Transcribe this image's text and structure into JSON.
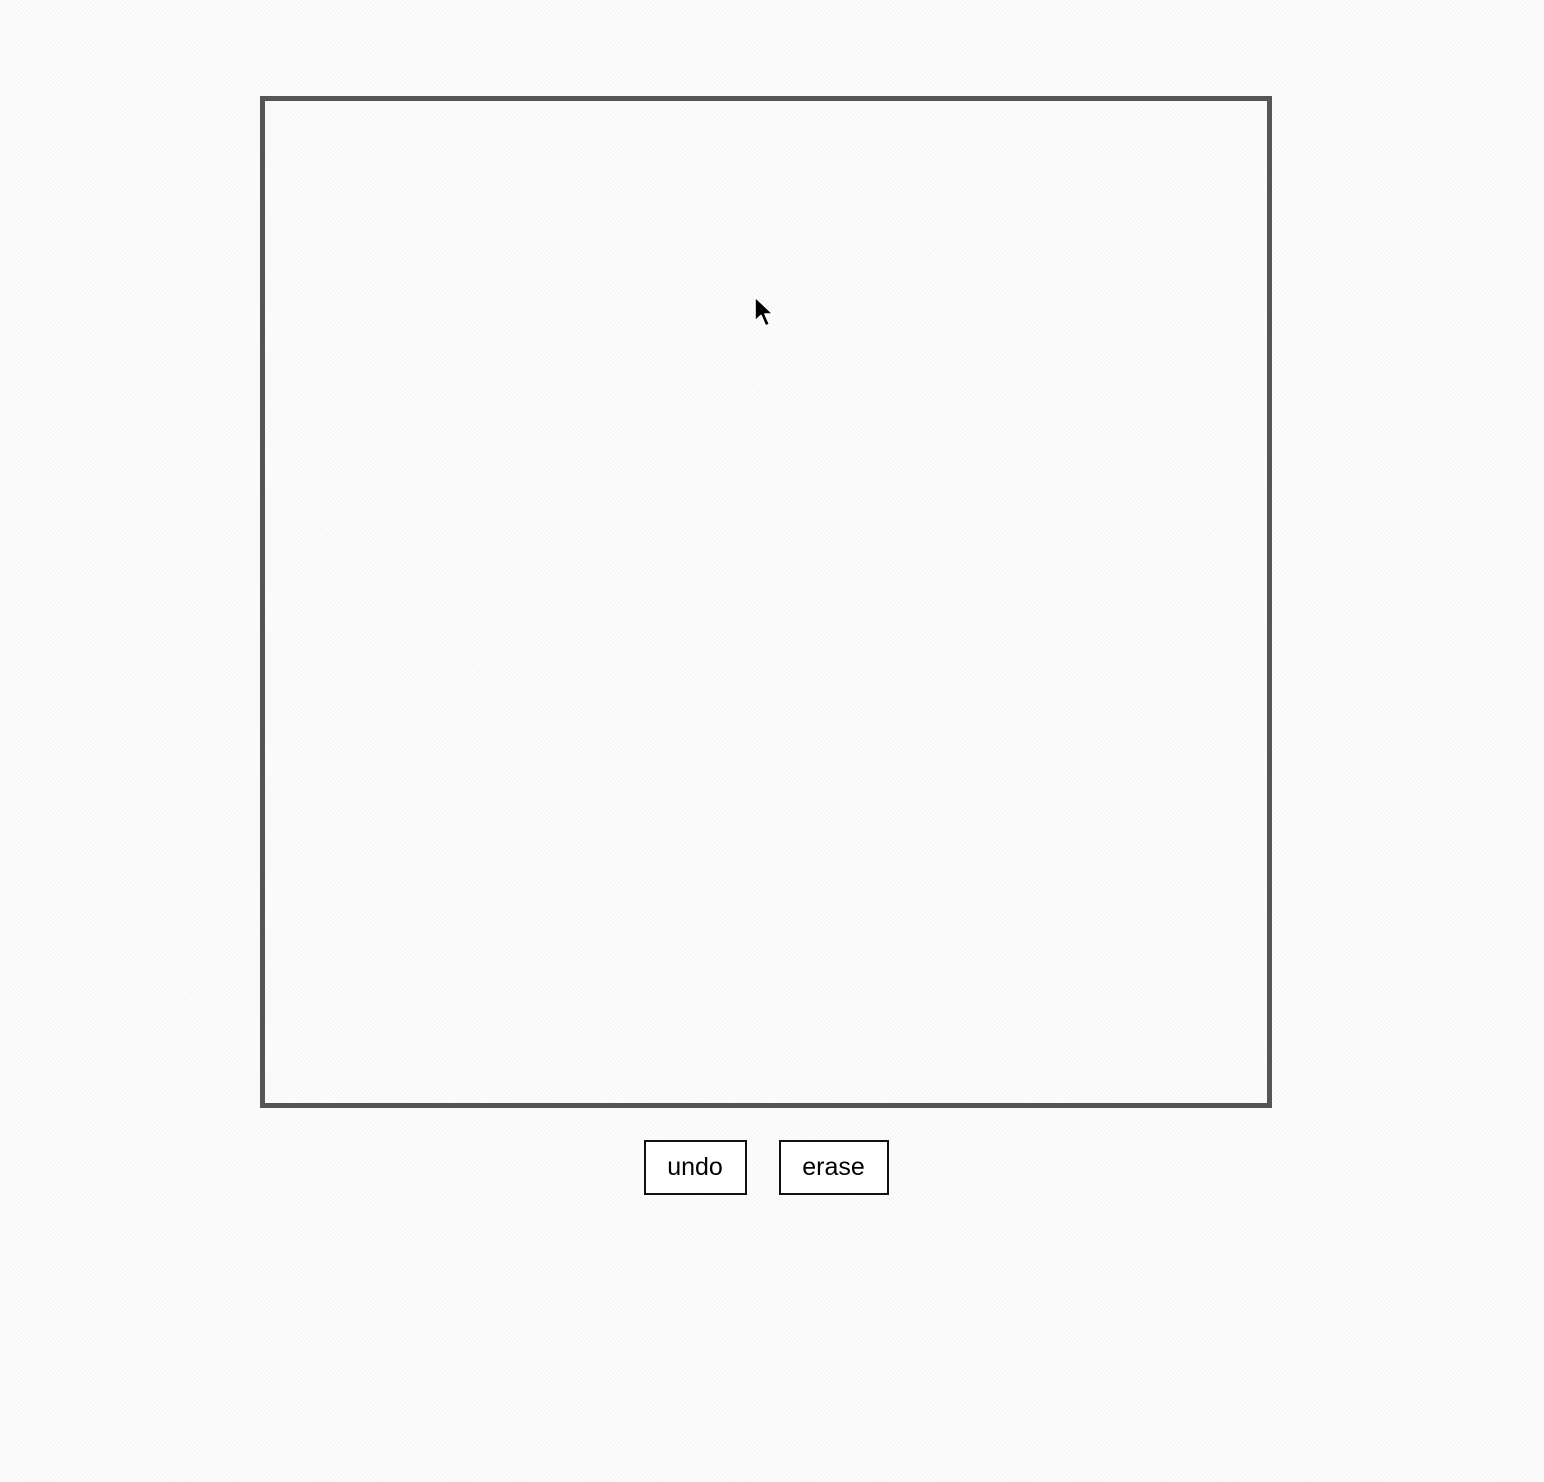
{
  "controls": {
    "undo_label": "undo",
    "erase_label": "erase"
  },
  "colors": {
    "canvas_border": "#555555",
    "button_border": "#111111"
  },
  "icons": {
    "cursor": "mouse-pointer-arrow"
  }
}
